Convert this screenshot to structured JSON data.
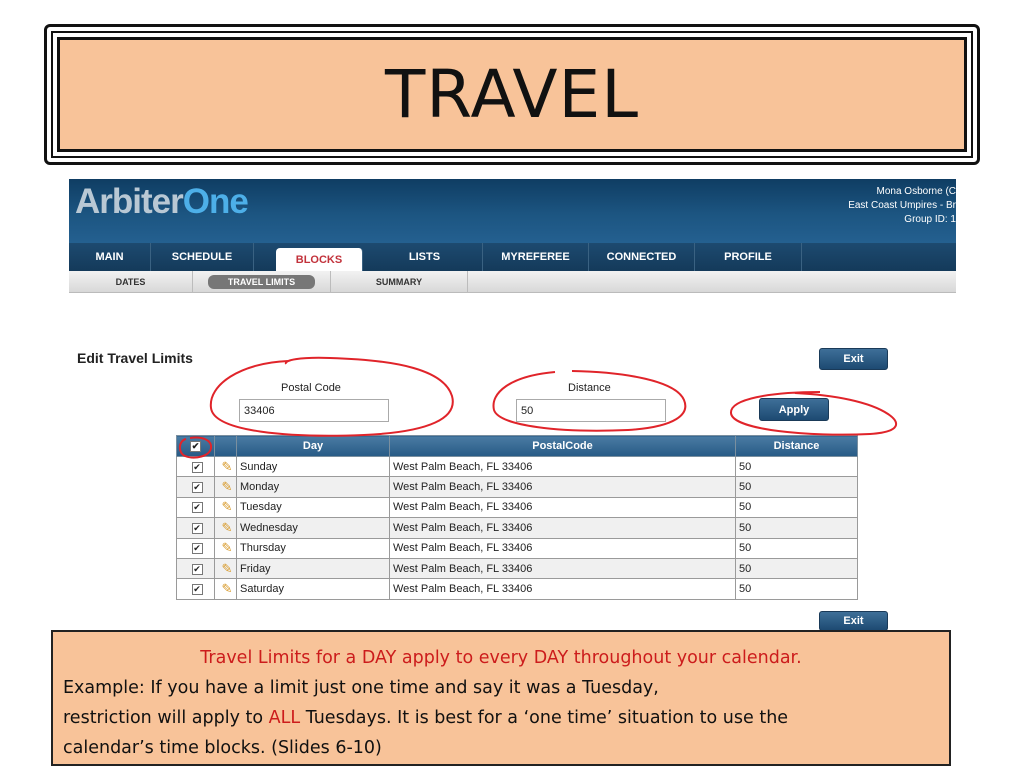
{
  "slide": {
    "title": "TRAVEL"
  },
  "app": {
    "logo_part1": "Arbiter",
    "logo_part2": "One",
    "user_name": "Mona Osborne (C",
    "user_group": "East Coast Umpires - Br",
    "user_group_id": "Group ID: 1",
    "main_nav": [
      "MAIN",
      "SCHEDULE",
      "BLOCKS",
      "LISTS",
      "MYREFEREE",
      "CONNECTED",
      "PROFILE"
    ],
    "active_main": "BLOCKS",
    "sub_nav": [
      "DATES",
      "TRAVEL LIMITS",
      "SUMMARY"
    ],
    "active_sub": "TRAVEL LIMITS"
  },
  "edit": {
    "heading": "Edit Travel Limits",
    "exit_label": "Exit",
    "apply_label": "Apply",
    "postal_label": "Postal Code",
    "postal_value": "33406",
    "distance_label": "Distance",
    "distance_value": "50"
  },
  "table": {
    "headers": [
      "",
      "",
      "Day",
      "PostalCode",
      "Distance"
    ],
    "rows": [
      {
        "day": "Sunday",
        "postal": "West Palm Beach, FL 33406",
        "distance": "50",
        "checked": true
      },
      {
        "day": "Monday",
        "postal": "West Palm Beach, FL 33406",
        "distance": "50",
        "checked": true
      },
      {
        "day": "Tuesday",
        "postal": "West Palm Beach, FL 33406",
        "distance": "50",
        "checked": true
      },
      {
        "day": "Wednesday",
        "postal": "West Palm Beach, FL 33406",
        "distance": "50",
        "checked": true
      },
      {
        "day": "Thursday",
        "postal": "West Palm Beach, FL 33406",
        "distance": "50",
        "checked": true
      },
      {
        "day": "Friday",
        "postal": "West Palm Beach, FL 33406",
        "distance": "50",
        "checked": true
      },
      {
        "day": "Saturday",
        "postal": "West Palm Beach, FL 33406",
        "distance": "50",
        "checked": true
      }
    ]
  },
  "note": {
    "line1": "Travel Limits for a DAY apply to every DAY throughout your calendar.",
    "line2": "Example:  If you have a limit  just one time and say it was a Tuesday,",
    "line3_pre": "restriction will apply to ",
    "line3_red": "ALL",
    "line3_post": " Tuesdays.   It is best for a ‘one time’ situation to use the",
    "line4": "calendar’s time blocks.  (Slides 6-10)"
  },
  "colors": {
    "banner": "#f8c399",
    "header_blue": "#1c5581",
    "accent_red": "#cc1c1c",
    "annotation_red": "#e0242a"
  }
}
